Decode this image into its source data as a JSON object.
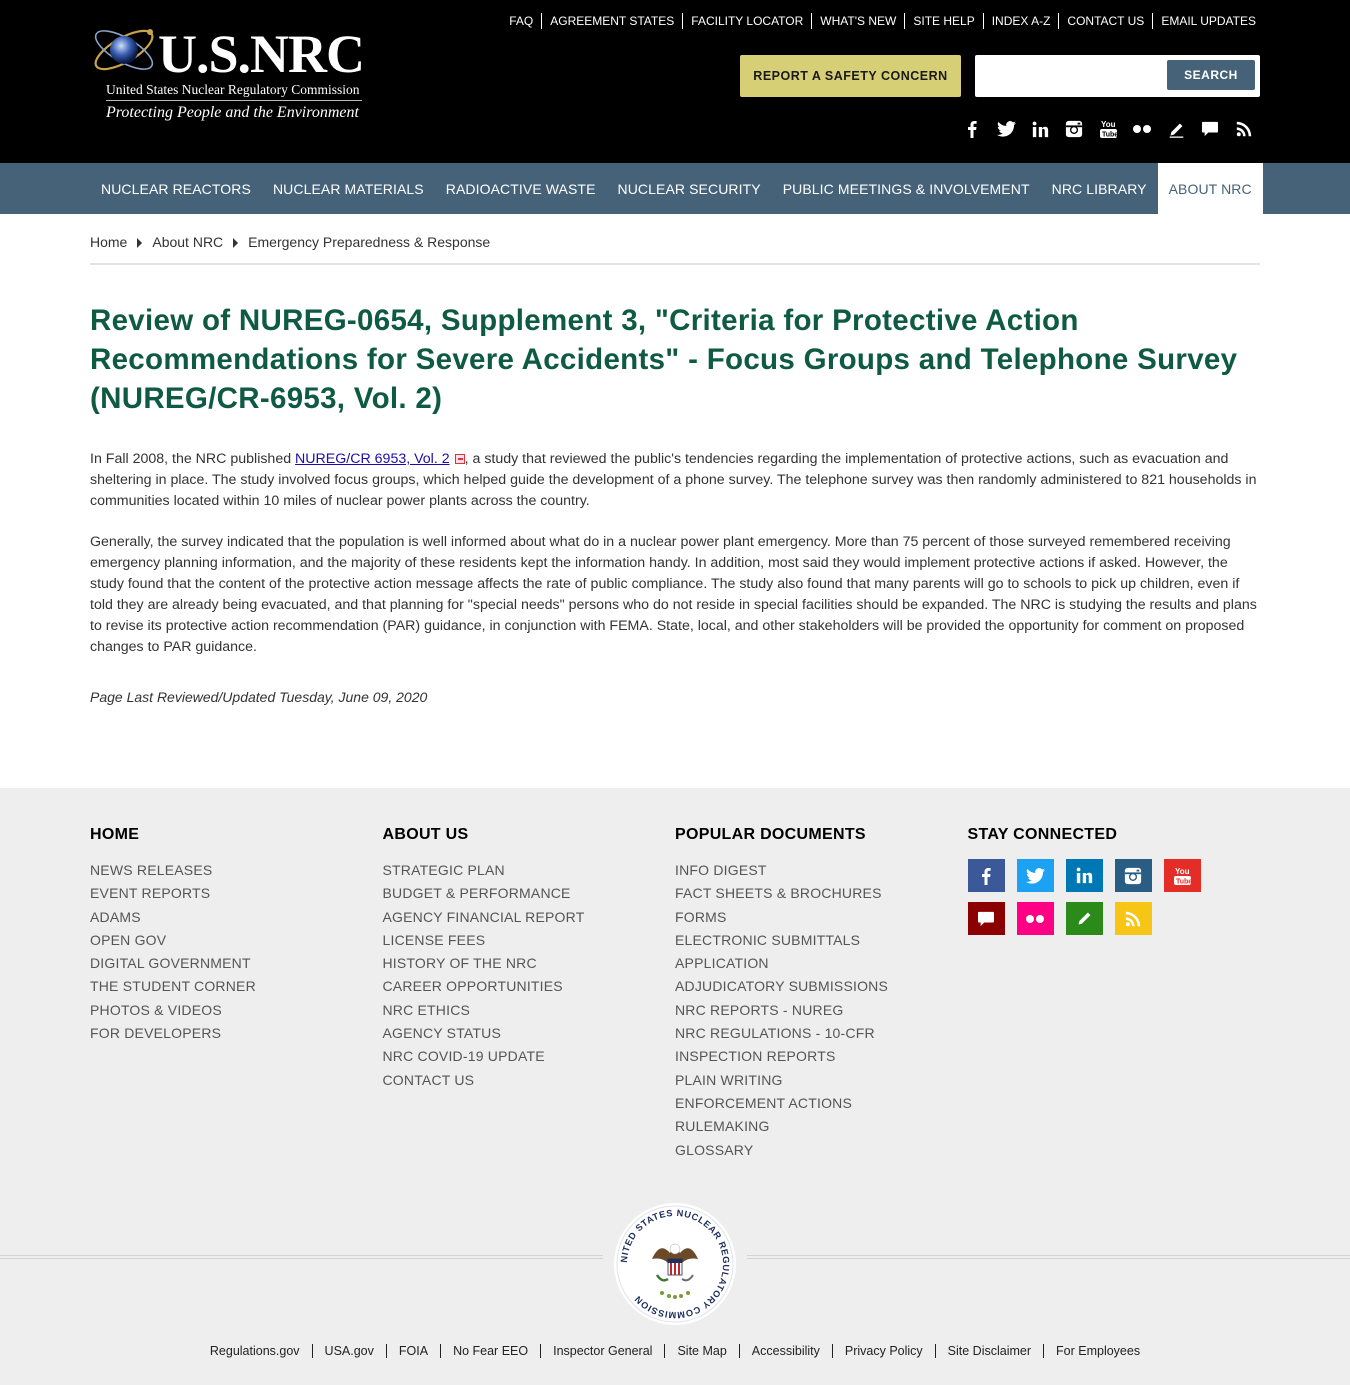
{
  "header": {
    "logo_text": "U.S.NRC",
    "logo_subtitle": "United States Nuclear Regulatory Commission",
    "logo_tagline": "Protecting People and the Environment",
    "util_links": [
      "FAQ",
      "AGREEMENT STATES",
      "FACILITY LOCATOR",
      "WHAT'S NEW",
      "SITE HELP",
      "INDEX A-Z",
      "CONTACT US",
      "EMAIL UPDATES"
    ],
    "report_button": "REPORT A SAFETY CONCERN",
    "search_placeholder": "",
    "search_button": "SEARCH",
    "social_icons": [
      "facebook-icon",
      "twitter-icon",
      "linkedin-icon",
      "instagram-icon",
      "youtube-icon",
      "flickr-icon",
      "blog-icon",
      "comment-icon",
      "rss-icon"
    ]
  },
  "main_nav": {
    "items": [
      "NUCLEAR REACTORS",
      "NUCLEAR MATERIALS",
      "RADIOACTIVE WASTE",
      "NUCLEAR SECURITY",
      "PUBLIC MEETINGS & INVOLVEMENT",
      "NRC LIBRARY",
      "ABOUT NRC"
    ],
    "active": "ABOUT NRC"
  },
  "breadcrumb": [
    "Home",
    "About NRC",
    "Emergency Preparedness & Response"
  ],
  "content": {
    "title": "Review of NUREG-0654, Supplement 3, \"Criteria for Protective Action Recommendations for Severe Accidents\" - Focus Groups and Telephone Survey (NUREG/CR-6953, Vol. 2)",
    "p1_before": "In Fall 2008, the NRC published ",
    "p1_link": "NUREG/CR 6953, Vol. 2",
    "p1_after": ", a study that reviewed the public's tendencies regarding the implementation of protective actions, such as evacuation and sheltering in place. The study involved focus groups, which helped guide the development of a phone survey. The telephone survey was then randomly administered to 821 households in communities located within 10 miles of nuclear power plants across the country.",
    "p2": "Generally, the survey indicated that the population is well informed about what do in a nuclear power plant emergency. More than 75 percent of those surveyed remembered receiving emergency planning information, and the majority of these residents kept the information handy. In addition, most said they would implement protective actions if asked. However, the study found that the content of the protective action message affects the rate of public compliance. The study also found that many parents will go to schools to pick up children, even if told they are already being evacuated, and that planning for \"special needs\" persons who do not reside in special facilities should be expanded. The NRC is studying the results and plans to revise its protective action recommendation (PAR) guidance, in conjunction with FEMA. State, local, and other stakeholders will be provided the opportunity for comment on proposed changes to PAR guidance.",
    "last_updated": "Page Last Reviewed/Updated Tuesday, June 09, 2020"
  },
  "footer": {
    "col_home": {
      "heading": "HOME",
      "links": [
        "NEWS RELEASES",
        "EVENT REPORTS",
        "ADAMS",
        "OPEN GOV",
        "DIGITAL GOVERNMENT",
        "THE STUDENT CORNER",
        "PHOTOS & VIDEOS",
        "FOR DEVELOPERS"
      ]
    },
    "col_about": {
      "heading": "ABOUT US",
      "links": [
        "STRATEGIC PLAN",
        "BUDGET & PERFORMANCE",
        "AGENCY FINANCIAL REPORT",
        "LICENSE FEES",
        "HISTORY OF THE NRC",
        "CAREER OPPORTUNITIES",
        "NRC ETHICS",
        "AGENCY STATUS",
        "NRC COVID-19 UPDATE",
        "CONTACT US"
      ]
    },
    "col_docs": {
      "heading": "POPULAR DOCUMENTS",
      "links": [
        "INFO DIGEST",
        "FACT SHEETS & BROCHURES",
        "FORMS",
        "ELECTRONIC SUBMITTALS",
        "APPLICATION",
        "ADJUDICATORY SUBMISSIONS",
        "NRC REPORTS - NUREG",
        "NRC REGULATIONS - 10-CFR",
        "INSPECTION REPORTS",
        "PLAIN WRITING",
        "ENFORCEMENT ACTIONS",
        "RULEMAKING",
        "GLOSSARY"
      ]
    },
    "col_stay": {
      "heading": "STAY CONNECTED",
      "icons": [
        {
          "name": "facebook-icon",
          "color": "#3b5998"
        },
        {
          "name": "twitter-icon",
          "color": "#1da1f2"
        },
        {
          "name": "linkedin-icon",
          "color": "#0077b5"
        },
        {
          "name": "instagram-icon",
          "color": "#2a5d84"
        },
        {
          "name": "youtube-icon",
          "color": "#e52d27"
        },
        {
          "name": "comment-icon",
          "color": "#8b0000"
        },
        {
          "name": "flickr-icon",
          "color": "#ff0084"
        },
        {
          "name": "blog-icon",
          "color": "#2b8a1a"
        },
        {
          "name": "rss-icon",
          "color": "#f6c515"
        }
      ]
    },
    "seal_text": "UNITED STATES NUCLEAR REGULATORY COMMISSION",
    "bottom_links": [
      "Regulations.gov",
      "USA.gov",
      "FOIA",
      "No Fear EEO",
      "Inspector General",
      "Site Map",
      "Accessibility",
      "Privacy Policy",
      "Site Disclaimer",
      "For Employees"
    ]
  },
  "colors": {
    "header_bg": "#000000",
    "nav_bg": "#456279",
    "title_green": "#0e5a42",
    "report_yellow": "#d7cf75",
    "footer_bg": "#eeeeee"
  }
}
